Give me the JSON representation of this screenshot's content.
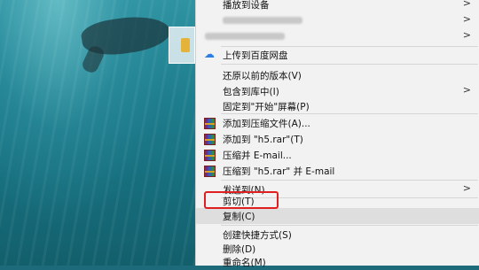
{
  "menu": {
    "items": [
      {
        "label": "播放到设备",
        "has_submenu": true
      },
      {
        "label": "",
        "has_submenu": true,
        "blurred": true
      },
      {
        "label": "",
        "has_submenu": true,
        "blurred": true
      },
      {
        "label": "上传到百度网盘",
        "icon": "baidu-cloud-icon"
      },
      {
        "label": "还原以前的版本(V)"
      },
      {
        "label": "包含到库中(I)",
        "has_submenu": true
      },
      {
        "label": "固定到\"开始\"屏幕(P)"
      },
      {
        "label": "添加到压缩文件(A)...",
        "icon": "winrar-icon"
      },
      {
        "label": "添加到 \"h5.rar\"(T)",
        "icon": "winrar-icon"
      },
      {
        "label": "压缩并 E-mail...",
        "icon": "winrar-icon"
      },
      {
        "label": "压缩到 \"h5.rar\" 并 E-mail",
        "icon": "winrar-icon"
      },
      {
        "label": "发送到(N)",
        "has_submenu": true
      },
      {
        "label": "剪切(T)",
        "annotated": true
      },
      {
        "label": "复制(C)",
        "highlighted": true
      },
      {
        "label": "创建快捷方式(S)"
      },
      {
        "label": "删除(D)"
      },
      {
        "label": "重命名(M)"
      }
    ],
    "submenu_arrow": ">",
    "colors": {
      "background": "#f2f2f2",
      "highlight": "#dedede",
      "annotation": "#e02020"
    }
  }
}
